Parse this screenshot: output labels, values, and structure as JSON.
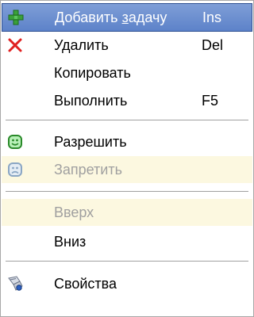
{
  "menu": {
    "add": {
      "label_before": "Добавить ",
      "label_underlined": "з",
      "label_after": "адачу",
      "shortcut": "Ins",
      "icon": "plus-icon"
    },
    "delete": {
      "label": "Удалить",
      "shortcut": "Del",
      "icon": "red-x-icon"
    },
    "copy": {
      "label": "Копировать"
    },
    "run": {
      "label": "Выполнить",
      "shortcut": "F5"
    },
    "allow": {
      "label": "Разрешить",
      "icon": "smile-icon"
    },
    "deny": {
      "label": "Запретить",
      "icon": "frown-icon",
      "disabled": true
    },
    "up": {
      "label": "Вверх",
      "disabled": true
    },
    "down": {
      "label": "Вниз"
    },
    "properties": {
      "label": "Свойства",
      "icon": "properties-icon"
    }
  },
  "colors": {
    "highlight": "#5d82c9",
    "disabled_bg": "#fcf8e0",
    "disabled_text": "#a0a0a0",
    "delete_icon": "#e02020",
    "add_icon": "#3aa03a"
  }
}
